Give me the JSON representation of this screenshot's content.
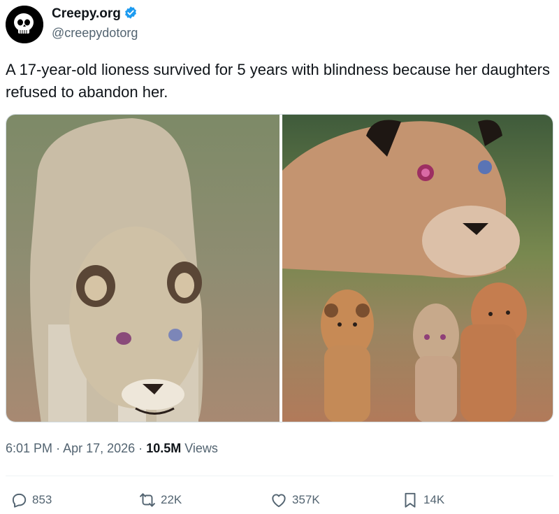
{
  "author": {
    "display_name": "Creepy.org",
    "handle": "@creepydotorg",
    "verified": true,
    "avatar_icon": "skull-icon",
    "verified_icon": "verified-badge-icon"
  },
  "tweet": {
    "text": "A 17-year-old lioness survived for 5 years with blindness because her daughters refused to abandon her."
  },
  "media": {
    "left_image": "lioness-closeup-photo",
    "right_image": "lioness-face-and-three-lions-photo"
  },
  "meta": {
    "time": "6:01 PM",
    "separator": "·",
    "date": "Apr 17, 2026",
    "views_count": "10.5M",
    "views_label": "Views"
  },
  "actions": {
    "replies": {
      "icon": "reply-icon",
      "count": "853"
    },
    "reposts": {
      "icon": "repost-icon",
      "count": "22K"
    },
    "likes": {
      "icon": "like-icon",
      "count": "357K"
    },
    "bookmarks": {
      "icon": "bookmark-icon",
      "count": "14K"
    }
  },
  "colors": {
    "text": "#0f1419",
    "secondary": "#536471",
    "verified": "#1d9bf0"
  }
}
